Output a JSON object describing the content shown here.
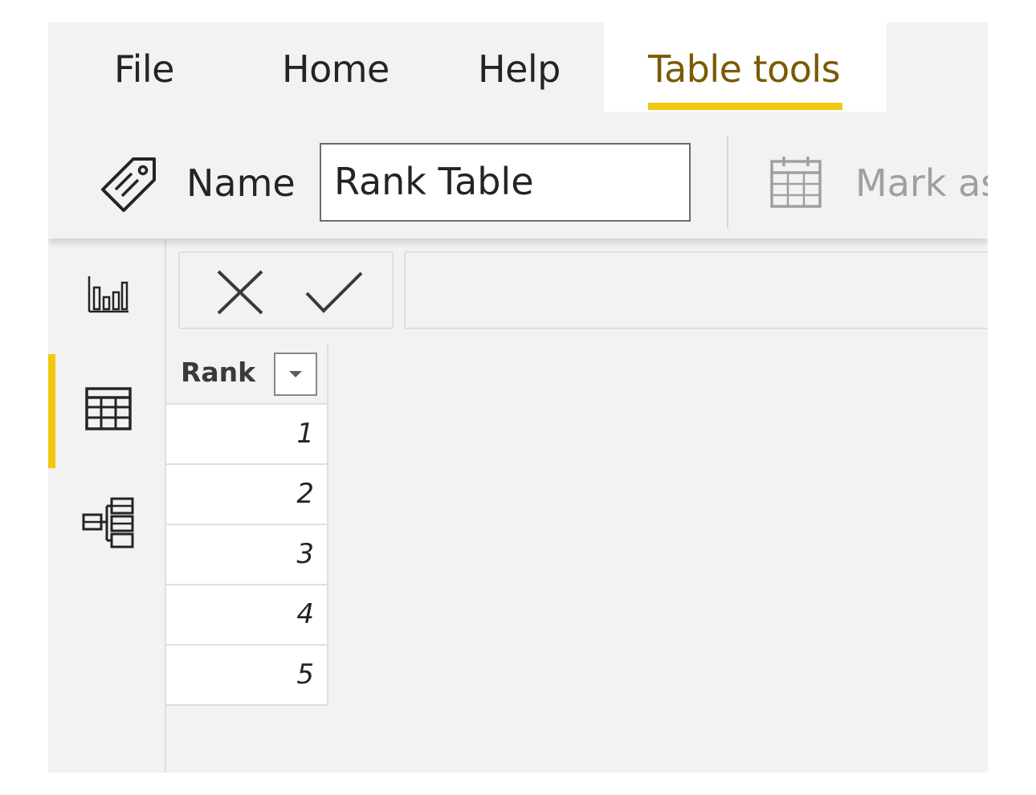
{
  "ribbon": {
    "tabs": [
      {
        "label": "File"
      },
      {
        "label": "Home"
      },
      {
        "label": "Help"
      },
      {
        "label": "Table tools",
        "active": true
      }
    ],
    "name_label": "Name",
    "name_value": "Rank Table",
    "mark_as_label": "Mark as",
    "name_icon": "tag-icon",
    "mark_icon": "calendar-icon"
  },
  "sidebar": {
    "items": [
      {
        "name": "report-view",
        "icon": "bar-chart-icon",
        "active": false
      },
      {
        "name": "data-view",
        "icon": "table-icon",
        "active": true
      },
      {
        "name": "model-view",
        "icon": "model-icon",
        "active": false
      }
    ]
  },
  "formula_bar": {
    "cancel_icon": "close-icon",
    "commit_icon": "check-icon",
    "text": ""
  },
  "table": {
    "column": "Rank",
    "rows": [
      "1",
      "2",
      "3",
      "4",
      "5"
    ]
  },
  "colors": {
    "accent": "#f2c811",
    "active_tab_text": "#7a5b00",
    "background": "#f3f2f1"
  }
}
